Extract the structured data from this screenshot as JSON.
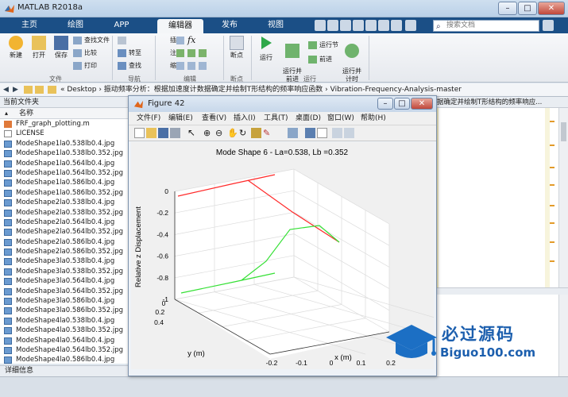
{
  "window": {
    "title": "MATLAB R2018a"
  },
  "tabs": [
    "主页",
    "绘图",
    "APP",
    "编辑器",
    "发布",
    "视图"
  ],
  "search": {
    "placeholder": "搜索文档"
  },
  "toolbar": {
    "file_group": "文件",
    "nav_group": "导航",
    "edit_group": "编辑",
    "breakpoint_group": "断点",
    "run_group": "运行",
    "new": "新建",
    "open": "打开",
    "save": "保存",
    "find_files": "查找文件",
    "compare": "比较",
    "print": "打印",
    "goto": "转至",
    "find": "查找",
    "insert": "插入",
    "comment": "注释",
    "indent": "缩进",
    "breakpoints": "断点",
    "run": "运行",
    "run_advance": "运行并\n前进",
    "run_section": "运行节",
    "advance": "前进",
    "run_time": "运行并\n计时"
  },
  "address": {
    "path": "«  Desktop  ›  振动频率分析：根据加速度计数据确定并绘制T形结构的频率响应函数  ›  Vibration-Frequency-Analysis-master"
  },
  "left_panel": {
    "title": "当前文件夹",
    "name_col": "名称",
    "files": [
      "FRF_graph_plotting.m",
      "LICENSE",
      "ModeShape1la0.538lb0.4.jpg",
      "ModeShape1la0.538lb0.352.jpg",
      "ModeShape1la0.564lb0.4.jpg",
      "ModeShape1la0.564lb0.352.jpg",
      "ModeShape1la0.586lb0.4.jpg",
      "ModeShape1la0.586lb0.352.jpg",
      "ModeShape2la0.538lb0.4.jpg",
      "ModeShape2la0.538lb0.352.jpg",
      "ModeShape2la0.564lb0.4.jpg",
      "ModeShape2la0.564lb0.352.jpg",
      "ModeShape2la0.586lb0.4.jpg",
      "ModeShape2la0.586lb0.352.jpg",
      "ModeShape3la0.538lb0.4.jpg",
      "ModeShape3la0.538lb0.352.jpg",
      "ModeShape3la0.564lb0.4.jpg",
      "ModeShape3la0.564lb0.352.jpg",
      "ModeShape3la0.586lb0.4.jpg",
      "ModeShape3la0.586lb0.352.jpg",
      "ModeShape4la0.538lb0.4.jpg",
      "ModeShape4la0.538lb0.352.jpg",
      "ModeShape4la0.564lb0.4.jpg",
      "ModeShape4la0.564lb0.352.jpg",
      "ModeShape4la0.586lb0.4.jpg"
    ],
    "details": "详细信息"
  },
  "editor": {
    "tab_text": "据确定并绘制T形结构的频率响应..."
  },
  "figure": {
    "title": "Figure 42",
    "menu": [
      "文件(F)",
      "编辑(E)",
      "查看(V)",
      "插入(I)",
      "工具(T)",
      "桌面(D)",
      "窗口(W)",
      "帮助(H)"
    ],
    "plot_title": "Mode Shape 6 - La=0.538, Lb =0.352",
    "zlabel": "Relative z Displacement",
    "xlabel": "x (m)",
    "ylabel": "y (m)",
    "z_ticks": [
      "0",
      "-0.2",
      "-0.4",
      "-0.6",
      "-0.8",
      "-1"
    ],
    "y_ticks": [
      "0.4",
      "0.2",
      "0"
    ],
    "x_ticks": [
      "-0.2",
      "-0.1",
      "0",
      "0.1",
      "0.2"
    ]
  },
  "watermark": {
    "brand": "必过源码",
    "url": "Biguo100.com"
  },
  "colors": {
    "ribbon": "#1b4f86",
    "red_line": "#ff2a2a",
    "green_line": "#35e035",
    "accent": "#1a6fc0"
  }
}
